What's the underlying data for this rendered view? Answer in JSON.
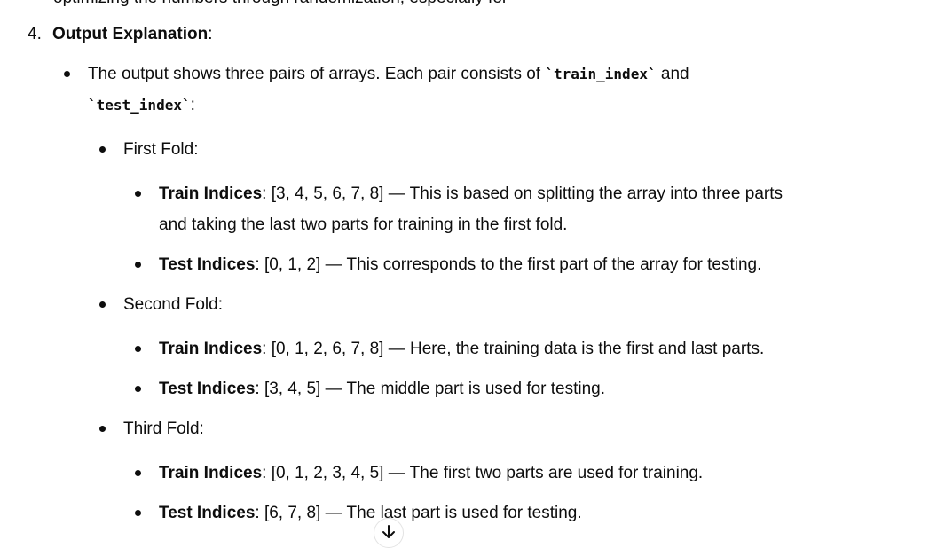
{
  "cutoff_text": "optimizing the numbers through randomization, especially for",
  "section": {
    "number": "4.",
    "title": "Output Explanation",
    "colon": ":"
  },
  "intro": {
    "line1_pre": "The output shows three pairs of arrays. Each pair consists of ",
    "code1": "`train_index`",
    "line1_post": " and",
    "code2": "`test_index`",
    "line2_post": ":"
  },
  "folds": [
    {
      "label": "First Fold",
      "train": {
        "label": "Train Indices",
        "text": ": [3, 4, 5, 6, 7, 8] — This is based on splitting the array into three parts",
        "cont": "and taking the last two parts for training in the first fold."
      },
      "test": {
        "label": "Test Indices",
        "text": ": [0, 1, 2] — This corresponds to the first part of the array for testing."
      }
    },
    {
      "label": "Second Fold",
      "train": {
        "label": "Train Indices",
        "text": ": [0, 1, 2, 6, 7, 8] — Here, the training data is the first and last parts."
      },
      "test": {
        "label": "Test Indices",
        "text": ": [3, 4, 5] — The middle part is used for testing."
      }
    },
    {
      "label": "Third Fold",
      "train": {
        "label": "Train Indices",
        "text": ": [0, 1, 2, 3, 4, 5] — The first two parts are used for training."
      },
      "test": {
        "label": "Test Indices",
        "text": ": [6, 7, 8] — The last part is used for testing."
      }
    }
  ],
  "colon": ":",
  "scroll_icon": "arrow-down-icon"
}
